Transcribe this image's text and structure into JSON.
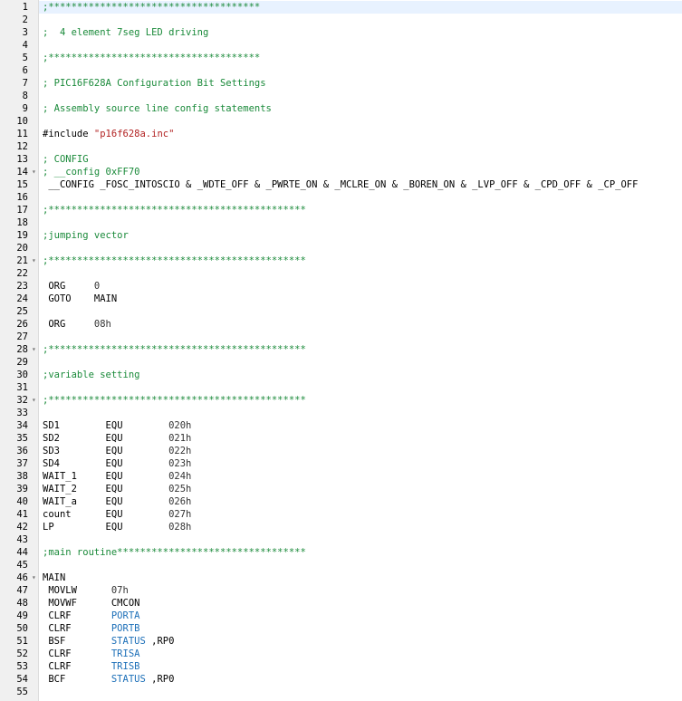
{
  "colors": {
    "comment": "#1a8a3a",
    "string": "#b22222",
    "register": "#1c6fb8",
    "text": "#000000",
    "gutter": "#f0f0f0",
    "current_line": "#e8f2ff"
  },
  "editor": {
    "lines": [
      {
        "num": "1",
        "fold": "",
        "segments": [
          {
            "text": ";*************************************",
            "cls": "comment"
          }
        ]
      },
      {
        "num": "2",
        "fold": "",
        "segments": []
      },
      {
        "num": "3",
        "fold": "",
        "segments": [
          {
            "text": ";  4 element 7seg LED driving",
            "cls": "comment"
          }
        ]
      },
      {
        "num": "4",
        "fold": "",
        "segments": []
      },
      {
        "num": "5",
        "fold": "",
        "segments": [
          {
            "text": ";*************************************",
            "cls": "comment"
          }
        ]
      },
      {
        "num": "6",
        "fold": "",
        "segments": []
      },
      {
        "num": "7",
        "fold": "",
        "segments": [
          {
            "text": "; PIC16F628A Configuration Bit Settings",
            "cls": "comment"
          }
        ]
      },
      {
        "num": "8",
        "fold": "",
        "segments": []
      },
      {
        "num": "9",
        "fold": "",
        "segments": [
          {
            "text": "; Assembly source line config statements",
            "cls": "comment"
          }
        ]
      },
      {
        "num": "10",
        "fold": "",
        "segments": []
      },
      {
        "num": "11",
        "fold": "",
        "segments": [
          {
            "text": "#include ",
            "cls": "directive"
          },
          {
            "text": "\"p16f628a.inc\"",
            "cls": "string"
          }
        ]
      },
      {
        "num": "12",
        "fold": "",
        "segments": []
      },
      {
        "num": "13",
        "fold": "",
        "segments": [
          {
            "text": "; CONFIG",
            "cls": "comment"
          }
        ]
      },
      {
        "num": "14",
        "fold": "▾",
        "segments": [
          {
            "text": "; __config 0xFF70",
            "cls": "comment"
          }
        ]
      },
      {
        "num": "15",
        "fold": "",
        "segments": [
          {
            "text": " __CONFIG _FOSC_INTOSCIO & _WDTE_OFF & _PWRTE_ON & _MCLRE_ON & _BOREN_ON & _LVP_OFF & _CPD_OFF & _CP_OFF",
            "cls": "macro"
          }
        ]
      },
      {
        "num": "16",
        "fold": "",
        "segments": []
      },
      {
        "num": "17",
        "fold": "",
        "segments": [
          {
            "text": ";*********************************************",
            "cls": "comment"
          }
        ]
      },
      {
        "num": "18",
        "fold": "",
        "segments": []
      },
      {
        "num": "19",
        "fold": "",
        "segments": [
          {
            "text": ";jumping vector",
            "cls": "comment"
          }
        ]
      },
      {
        "num": "20",
        "fold": "",
        "segments": []
      },
      {
        "num": "21",
        "fold": "▾",
        "segments": [
          {
            "text": ";*********************************************",
            "cls": "comment"
          }
        ]
      },
      {
        "num": "22",
        "fold": "",
        "segments": []
      },
      {
        "num": "23",
        "fold": "",
        "segments": [
          {
            "text": " ORG     ",
            "cls": "kw"
          },
          {
            "text": "0",
            "cls": "num"
          }
        ]
      },
      {
        "num": "24",
        "fold": "",
        "segments": [
          {
            "text": " GOTO    ",
            "cls": "kw"
          },
          {
            "text": "MAIN",
            "cls": "plain"
          }
        ]
      },
      {
        "num": "25",
        "fold": "",
        "segments": []
      },
      {
        "num": "26",
        "fold": "",
        "segments": [
          {
            "text": " ORG     ",
            "cls": "kw"
          },
          {
            "text": "08h",
            "cls": "num"
          }
        ]
      },
      {
        "num": "27",
        "fold": "",
        "segments": []
      },
      {
        "num": "28",
        "fold": "▾",
        "segments": [
          {
            "text": ";*********************************************",
            "cls": "comment"
          }
        ]
      },
      {
        "num": "29",
        "fold": "",
        "segments": []
      },
      {
        "num": "30",
        "fold": "",
        "segments": [
          {
            "text": ";variable setting",
            "cls": "comment"
          }
        ]
      },
      {
        "num": "31",
        "fold": "",
        "segments": []
      },
      {
        "num": "32",
        "fold": "▾",
        "segments": [
          {
            "text": ";*********************************************",
            "cls": "comment"
          }
        ]
      },
      {
        "num": "33",
        "fold": "",
        "segments": []
      },
      {
        "num": "34",
        "fold": "",
        "segments": [
          {
            "text": "SD1        ",
            "cls": "label"
          },
          {
            "text": "EQU        ",
            "cls": "kw"
          },
          {
            "text": "020h",
            "cls": "num"
          }
        ]
      },
      {
        "num": "35",
        "fold": "",
        "segments": [
          {
            "text": "SD2        ",
            "cls": "label"
          },
          {
            "text": "EQU        ",
            "cls": "kw"
          },
          {
            "text": "021h",
            "cls": "num"
          }
        ]
      },
      {
        "num": "36",
        "fold": "",
        "segments": [
          {
            "text": "SD3        ",
            "cls": "label"
          },
          {
            "text": "EQU        ",
            "cls": "kw"
          },
          {
            "text": "022h",
            "cls": "num"
          }
        ]
      },
      {
        "num": "37",
        "fold": "",
        "segments": [
          {
            "text": "SD4        ",
            "cls": "label"
          },
          {
            "text": "EQU        ",
            "cls": "kw"
          },
          {
            "text": "023h",
            "cls": "num"
          }
        ]
      },
      {
        "num": "38",
        "fold": "",
        "segments": [
          {
            "text": "WAIT_1     ",
            "cls": "label"
          },
          {
            "text": "EQU        ",
            "cls": "kw"
          },
          {
            "text": "024h",
            "cls": "num"
          }
        ]
      },
      {
        "num": "39",
        "fold": "",
        "segments": [
          {
            "text": "WAIT_2     ",
            "cls": "label"
          },
          {
            "text": "EQU        ",
            "cls": "kw"
          },
          {
            "text": "025h",
            "cls": "num"
          }
        ]
      },
      {
        "num": "40",
        "fold": "",
        "segments": [
          {
            "text": "WAIT_a     ",
            "cls": "label"
          },
          {
            "text": "EQU        ",
            "cls": "kw"
          },
          {
            "text": "026h",
            "cls": "num"
          }
        ]
      },
      {
        "num": "41",
        "fold": "",
        "segments": [
          {
            "text": "count      ",
            "cls": "label"
          },
          {
            "text": "EQU        ",
            "cls": "kw"
          },
          {
            "text": "027h",
            "cls": "num"
          }
        ]
      },
      {
        "num": "42",
        "fold": "",
        "segments": [
          {
            "text": "LP         ",
            "cls": "label"
          },
          {
            "text": "EQU        ",
            "cls": "kw"
          },
          {
            "text": "028h",
            "cls": "num"
          }
        ]
      },
      {
        "num": "43",
        "fold": "",
        "segments": []
      },
      {
        "num": "44",
        "fold": "",
        "segments": [
          {
            "text": ";main routine*********************************",
            "cls": "comment"
          }
        ]
      },
      {
        "num": "45",
        "fold": "",
        "segments": []
      },
      {
        "num": "46",
        "fold": "▾",
        "segments": [
          {
            "text": "MAIN",
            "cls": "label"
          }
        ]
      },
      {
        "num": "47",
        "fold": "",
        "segments": [
          {
            "text": " MOVLW      ",
            "cls": "kw"
          },
          {
            "text": "07h",
            "cls": "num"
          }
        ]
      },
      {
        "num": "48",
        "fold": "",
        "segments": [
          {
            "text": " MOVWF      ",
            "cls": "kw"
          },
          {
            "text": "CMCON",
            "cls": "plain"
          }
        ]
      },
      {
        "num": "49",
        "fold": "",
        "segments": [
          {
            "text": " CLRF       ",
            "cls": "kw"
          },
          {
            "text": "PORTA",
            "cls": "reg"
          }
        ]
      },
      {
        "num": "50",
        "fold": "",
        "segments": [
          {
            "text": " CLRF       ",
            "cls": "kw"
          },
          {
            "text": "PORTB",
            "cls": "reg"
          }
        ]
      },
      {
        "num": "51",
        "fold": "",
        "segments": [
          {
            "text": " BSF        ",
            "cls": "kw"
          },
          {
            "text": "STATUS",
            "cls": "reg"
          },
          {
            "text": " ,RP0",
            "cls": "plain"
          }
        ]
      },
      {
        "num": "52",
        "fold": "",
        "segments": [
          {
            "text": " CLRF       ",
            "cls": "kw"
          },
          {
            "text": "TRISA",
            "cls": "reg"
          }
        ]
      },
      {
        "num": "53",
        "fold": "",
        "segments": [
          {
            "text": " CLRF       ",
            "cls": "kw"
          },
          {
            "text": "TRISB",
            "cls": "reg"
          }
        ]
      },
      {
        "num": "54",
        "fold": "",
        "segments": [
          {
            "text": " BCF        ",
            "cls": "kw"
          },
          {
            "text": "STATUS",
            "cls": "reg"
          },
          {
            "text": " ,RP0",
            "cls": "plain"
          }
        ]
      },
      {
        "num": "55",
        "fold": "",
        "segments": []
      }
    ]
  }
}
